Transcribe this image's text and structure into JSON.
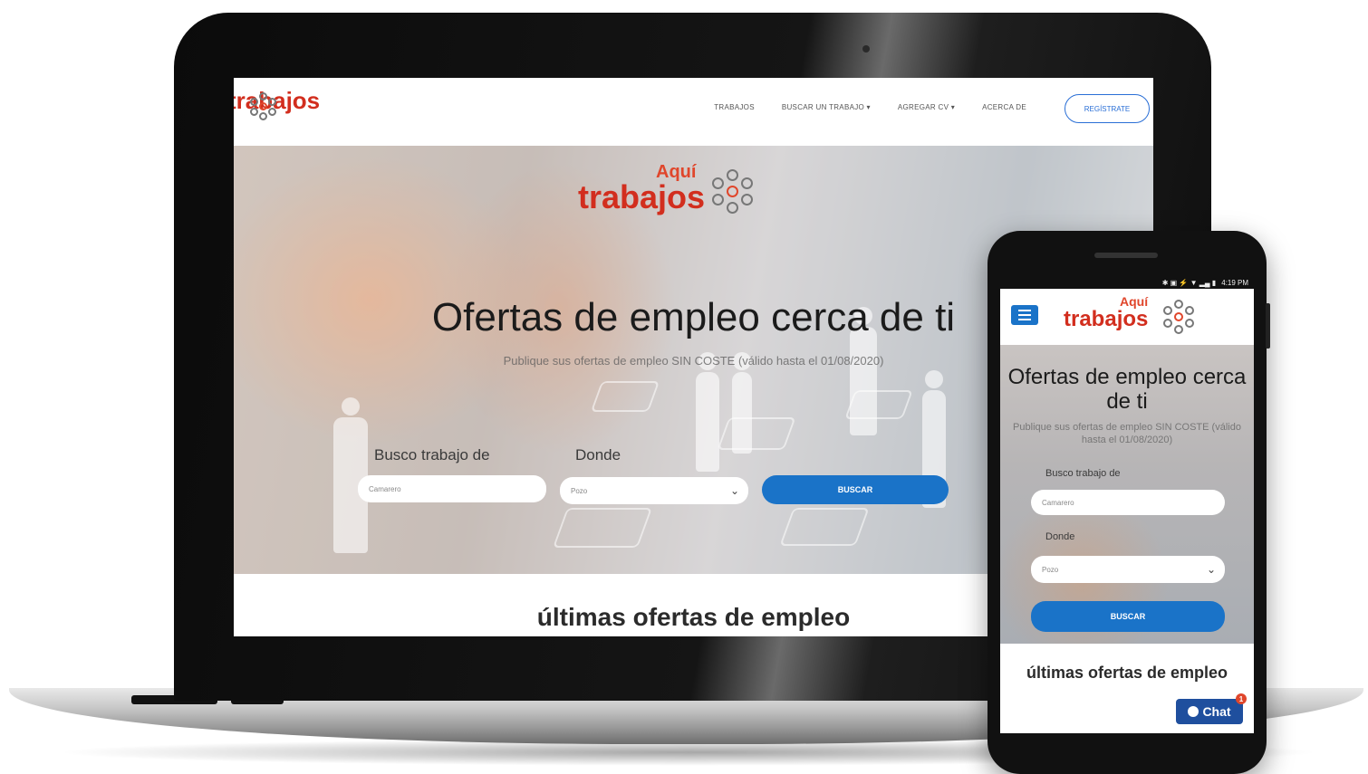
{
  "brand": {
    "aqui": "Aquí",
    "name": "trabajos"
  },
  "desktop": {
    "nav": {
      "items": [
        "TRABAJOS",
        "BUSCAR UN TRABAJO ▾",
        "AGREGAR CV ▾",
        "ACERCA DE"
      ],
      "register": "REGÍSTRATE"
    },
    "hero": {
      "title": "Ofertas de empleo cerca de ti",
      "subtitle": "Publique sus ofertas de empleo SIN COSTE (válido hasta el 01/08/2020)",
      "job_label": "Busco trabajo de",
      "job_placeholder": "Camarero",
      "where_label": "Donde",
      "where_value": "Pozo",
      "search_button": "BUSCAR"
    },
    "latest_title": "últimas ofertas de empleo"
  },
  "mobile": {
    "status_time": "4:19 PM",
    "status_icons": "✱ ▣ ⚡ ▼ ▂▄ ▮",
    "hero": {
      "title": "Ofertas de empleo cerca de ti",
      "subtitle": "Publique sus ofertas de empleo SIN COSTE (válido hasta el 01/08/2020)",
      "job_label": "Busco trabajo de",
      "job_placeholder": "Camarero",
      "where_label": "Donde",
      "where_value": "Pozo",
      "search_button": "BUSCAR"
    },
    "latest_title": "últimas ofertas de empleo",
    "chat_label": "Chat",
    "chat_badge": "1"
  },
  "colors": {
    "accent": "#1a73c8",
    "brand_red": "#d22e1e",
    "chat": "#1f4f9e"
  }
}
